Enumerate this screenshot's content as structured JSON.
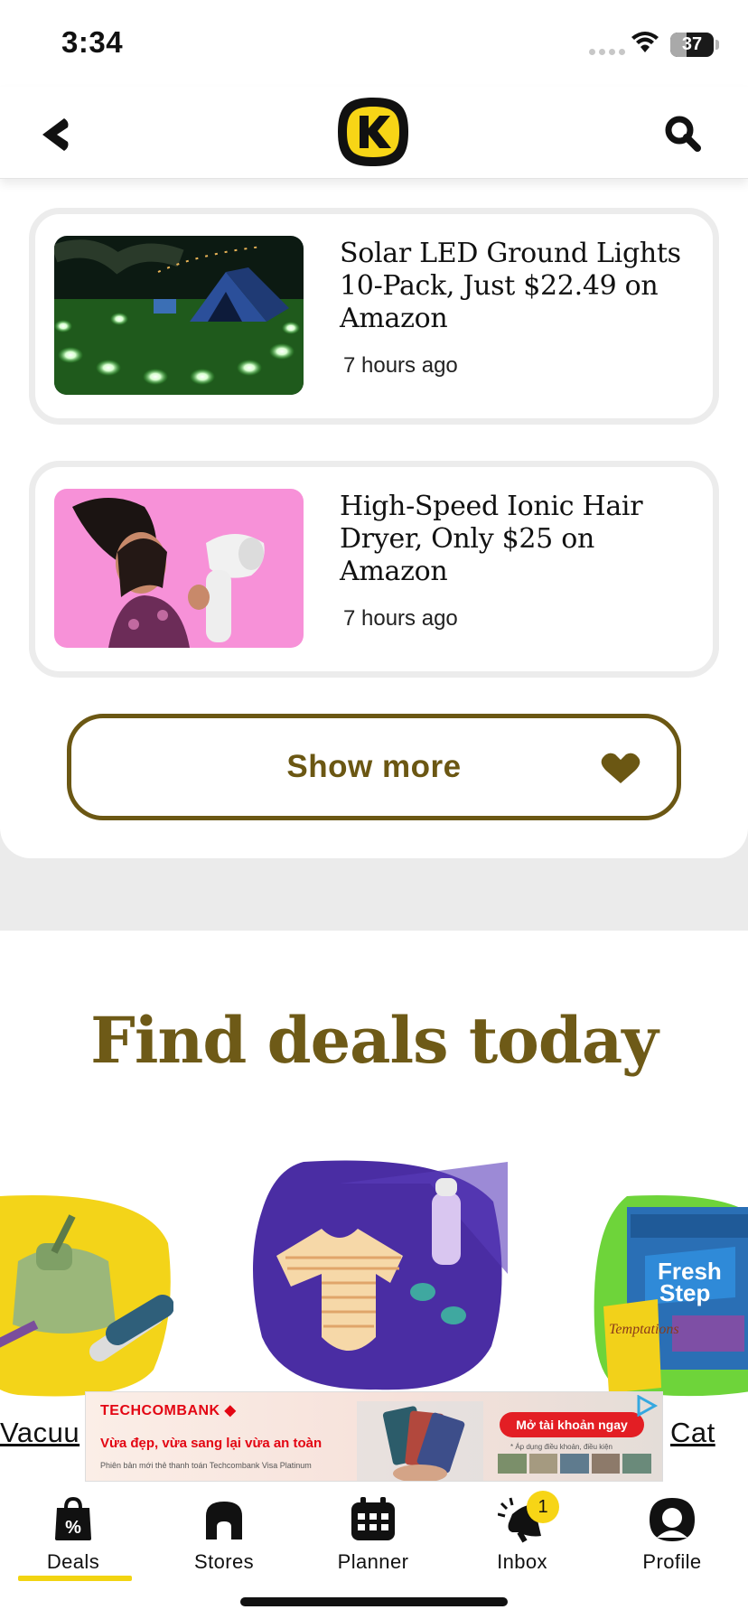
{
  "status_bar": {
    "time": "3:34",
    "battery": "37",
    "battery_level_percent": 37
  },
  "header": {
    "logo_icon": "k-logo-icon",
    "back_icon": "chevron-left-icon",
    "search_icon": "search-icon"
  },
  "deals": [
    {
      "title": "Solar LED Ground Lights 10-Pack, Just $22.49 on Amazon",
      "time": "7 hours ago",
      "image": "solar-lights-campsite-image"
    },
    {
      "title": "High-Speed Ionic Hair Dryer, Only $25 on Amazon",
      "time": "7 hours ago",
      "image": "hair-dryer-girl-image"
    }
  ],
  "show_more": {
    "label": "Show more"
  },
  "find_deals": {
    "title": "Find deals today",
    "categories": [
      {
        "label": "Vacuu",
        "image": "vacuum-image",
        "color": "#f3d419"
      },
      {
        "label": "",
        "image": "baby-onesie-bottle-image",
        "color": "#4a2da3"
      },
      {
        "label": "Cat",
        "image": "cat-litter-treats-image",
        "color": "#6ed43a"
      }
    ]
  },
  "ad": {
    "brand": "TECHCOMBANK",
    "headline": "Vừa đẹp, vừa sang lại vừa an toàn",
    "subtext": "Phiên bản mới thẻ thanh toán Techcombank Visa Platinum",
    "cta": "Mở tài khoản ngay",
    "disclaimer": "* Áp dụng điều khoản, điều kiện"
  },
  "tabs": [
    {
      "label": "Deals",
      "icon": "shopping-bag-percent-icon",
      "active": true
    },
    {
      "label": "Stores",
      "icon": "store-icon",
      "active": false
    },
    {
      "label": "Planner",
      "icon": "calendar-icon",
      "active": false
    },
    {
      "label": "Inbox",
      "icon": "megaphone-icon",
      "active": false,
      "badge": "1"
    },
    {
      "label": "Profile",
      "icon": "profile-icon",
      "active": false
    }
  ],
  "colors": {
    "brand_yellow": "#f7d516",
    "accent_olive": "#6b5713",
    "ad_red": "#e30613"
  }
}
